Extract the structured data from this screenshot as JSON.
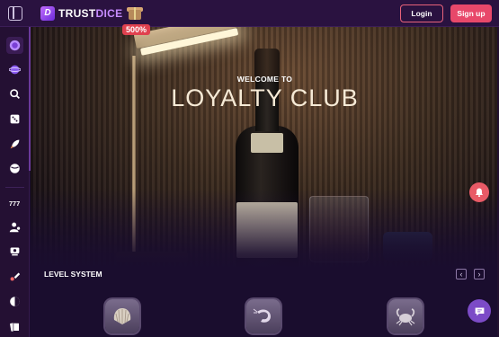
{
  "header": {
    "logo_text_a": "TRUST",
    "logo_text_b": "DICE",
    "logo_mark": "D",
    "promo_badge": "500%",
    "login_label": "Login",
    "signup_label": "Sign up"
  },
  "sidebar": {
    "items": [
      {
        "name": "sidebar-item-promo",
        "icon": "purple-orb-icon"
      },
      {
        "name": "sidebar-item-vip",
        "icon": "planet-icon"
      },
      {
        "name": "sidebar-item-search",
        "icon": "search-icon"
      },
      {
        "name": "sidebar-item-dice",
        "icon": "dice-icon"
      },
      {
        "name": "sidebar-item-rocket",
        "icon": "rocket-icon"
      },
      {
        "name": "sidebar-item-sports",
        "icon": "ball-icon"
      },
      {
        "name": "sidebar-item-slots",
        "icon": "slots-777-icon"
      },
      {
        "name": "sidebar-item-live-dealer",
        "icon": "dealer-icon"
      },
      {
        "name": "sidebar-item-table-games",
        "icon": "poker-table-icon"
      },
      {
        "name": "sidebar-item-originals",
        "icon": "rocket-diag-icon"
      },
      {
        "name": "sidebar-item-crypto",
        "icon": "coin-icon"
      },
      {
        "name": "sidebar-item-cards",
        "icon": "cards-icon"
      }
    ]
  },
  "hero": {
    "subtitle": "WELCOME TO",
    "title": "LOYALTY CLUB"
  },
  "level_system": {
    "title": "LEVEL SYSTEM",
    "prev_arrow": "‹",
    "next_arrow": "›",
    "levels": [
      {
        "icon": "shell-icon"
      },
      {
        "icon": "shrimp-icon"
      },
      {
        "icon": "crab-icon"
      }
    ]
  },
  "colors": {
    "brand": "#e8486a",
    "accent": "#7c4bc7",
    "background": "#1a0d2e"
  }
}
